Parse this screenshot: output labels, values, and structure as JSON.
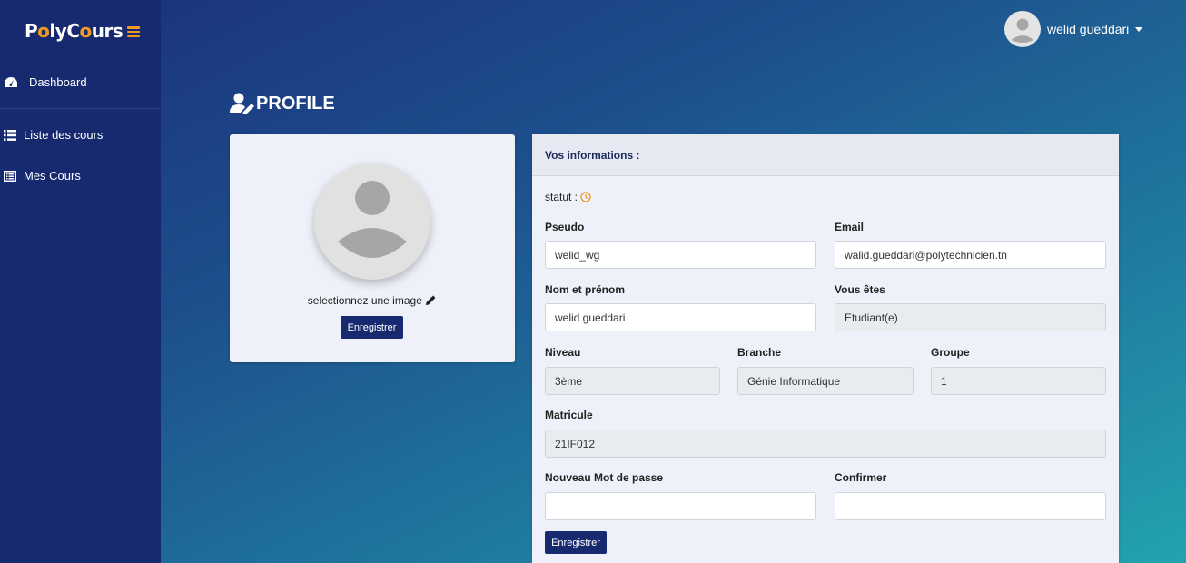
{
  "brand": {
    "part1": "P",
    "part_o": "o",
    "part2": "ly",
    "part3": "C",
    "part_o2": "o",
    "part4": "urs"
  },
  "sidebar": {
    "items": [
      {
        "label": "Dashboard",
        "icon": "tachometer-icon"
      },
      {
        "label": "Liste des cours",
        "icon": "list-icon"
      },
      {
        "label": "Mes Cours",
        "icon": "list-alt-icon"
      }
    ]
  },
  "user": {
    "name": "welid gueddari"
  },
  "page": {
    "title": "PROFILE"
  },
  "avatar_card": {
    "select_label": "selectionnez une image",
    "save_label": "Enregistrer"
  },
  "info": {
    "header": "Vos informations :",
    "statut_label": "statut :",
    "fields": {
      "pseudo": {
        "label": "Pseudo",
        "value": "welid_wg"
      },
      "email": {
        "label": "Email",
        "value": "walid.gueddari@polytechnicien.tn"
      },
      "nom": {
        "label": "Nom et prénom",
        "value": "welid gueddari"
      },
      "vous_etes": {
        "label": "Vous êtes",
        "value": "Etudiant(e)"
      },
      "niveau": {
        "label": "Niveau",
        "value": "3ème"
      },
      "branche": {
        "label": "Branche",
        "value": "Génie Informatique"
      },
      "groupe": {
        "label": "Groupe",
        "value": "1"
      },
      "matricule": {
        "label": "Matricule",
        "value": "21IF012"
      },
      "new_pwd": {
        "label": "Nouveau Mot de passe",
        "value": ""
      },
      "confirm": {
        "label": "Confirmer",
        "value": ""
      }
    },
    "save_label": "Enregistrer"
  },
  "colors": {
    "sidebar": "#172a70",
    "accent": "#f29a1f",
    "button": "#172a70"
  }
}
